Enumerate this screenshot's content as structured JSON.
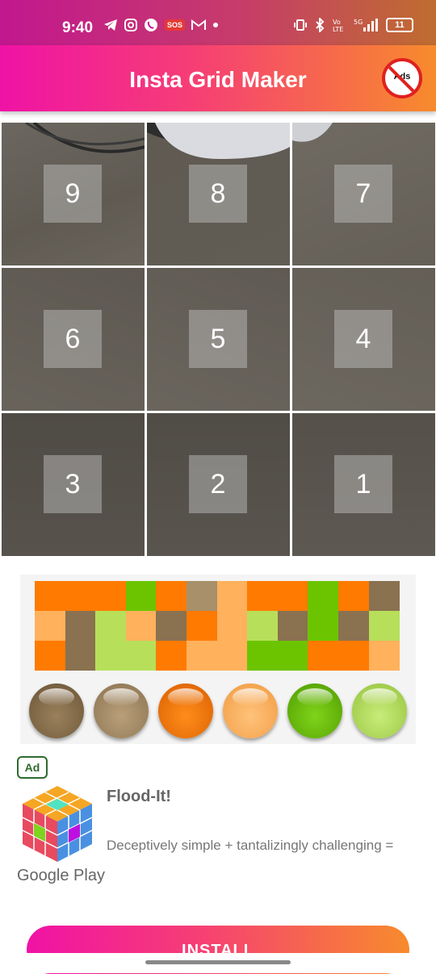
{
  "status_bar": {
    "time": "9:40",
    "sos": "SOS",
    "battery": "11",
    "left_icons": [
      "telegram-icon",
      "instagram-icon",
      "whatsapp-icon",
      "sos-icon",
      "gmail-icon",
      "dot-icon"
    ],
    "right_icons": [
      "vibrate-icon",
      "bluetooth-icon",
      "volte-icon",
      "5g-signal-icon",
      "battery-icon"
    ]
  },
  "app_bar": {
    "title": "Insta Grid Maker",
    "no_ads_label": "Ads"
  },
  "grid": {
    "cells": [
      {
        "number": "9"
      },
      {
        "number": "8"
      },
      {
        "number": "7"
      },
      {
        "number": "6"
      },
      {
        "number": "5"
      },
      {
        "number": "4"
      },
      {
        "number": "3"
      },
      {
        "number": "2"
      },
      {
        "number": "1"
      }
    ]
  },
  "ad": {
    "badge": "Ad",
    "title": "Flood-It!",
    "description": "Deceptively simple + tantalizingly challenging =",
    "store": "Google Play",
    "install_label": "INSTALL",
    "colors": {
      "orange": "#ff7a00",
      "brown": "#8a7150",
      "green": "#6cc400",
      "light_green": "#b7df5a",
      "peach": "#ffb15c",
      "tan": "#a8906a"
    }
  },
  "colors": {
    "accent_start": "#f012a6",
    "accent_end": "#f78b2c"
  }
}
